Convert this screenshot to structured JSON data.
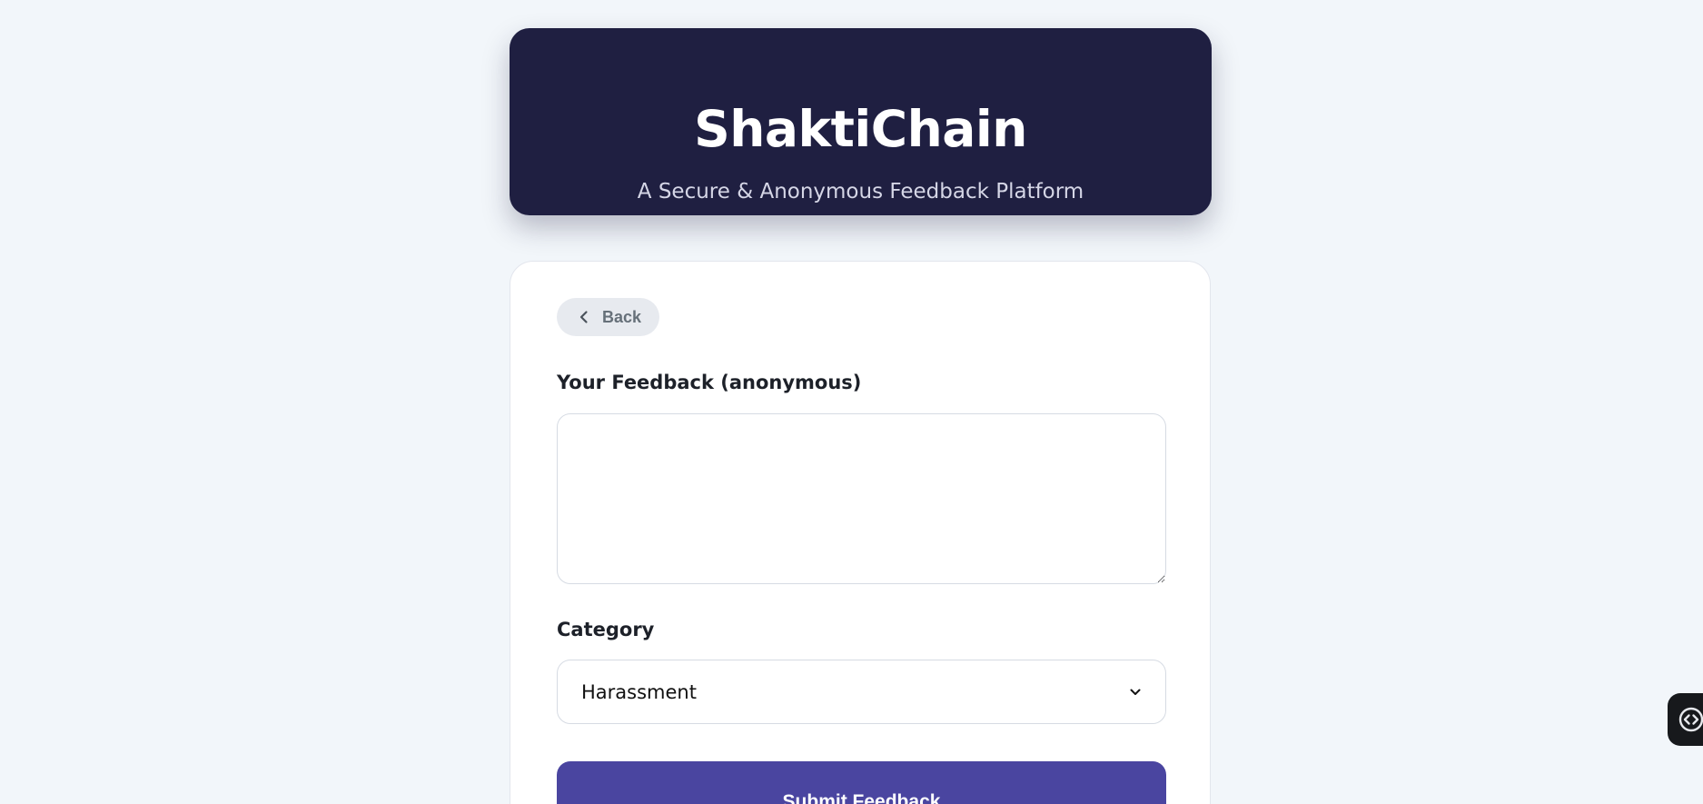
{
  "header": {
    "title": "ShaktiChain",
    "subtitle": "A Secure & Anonymous Feedback Platform"
  },
  "form": {
    "back_label": "Back",
    "feedback_label": "Your Feedback (anonymous)",
    "feedback_value": "",
    "category_label": "Category",
    "category_value": "Harassment",
    "submit_label": "Submit Feedback"
  },
  "icons": {
    "back": "chevron-left-icon",
    "select": "chevron-down-icon",
    "widget": "code-brackets-icon"
  },
  "colors": {
    "background": "#f2f6fa",
    "header_bg": "#1f1f41",
    "accent": "#4a45a0",
    "back_button_bg": "#e7eaef"
  }
}
